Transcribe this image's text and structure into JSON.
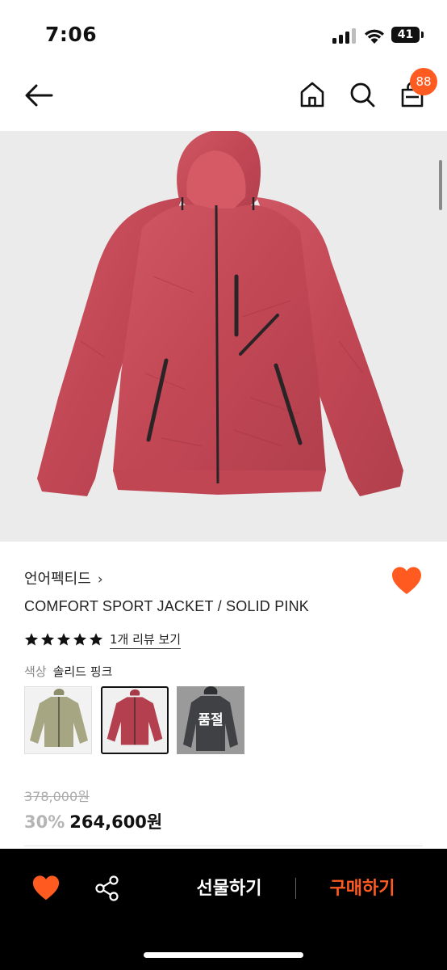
{
  "status_bar": {
    "time": "7:06",
    "battery": "41"
  },
  "header": {
    "cart_count": "88"
  },
  "product": {
    "brand": "언어펙티드",
    "brand_chevron": "›",
    "name": "COMFORT SPORT JACKET / SOLID PINK",
    "rating": 5,
    "review_link": "1개 리뷰 보기",
    "color_label": "색상",
    "color_value": "솔리드 핑크",
    "swatches": [
      {
        "color": "#a7a682",
        "selected": false,
        "sold_out": false
      },
      {
        "color": "#b4404f",
        "selected": true,
        "sold_out": false
      },
      {
        "color": "#3f4144",
        "selected": false,
        "sold_out": true,
        "sold_out_label": "품절"
      }
    ],
    "original_price": "378,000원",
    "discount": "30%",
    "sale_price": "264,600원",
    "jacket_color": "#c44a58",
    "accent_color": "#ff5a1f"
  },
  "bottom_bar": {
    "gift_label": "선물하기",
    "buy_label": "구매하기"
  }
}
